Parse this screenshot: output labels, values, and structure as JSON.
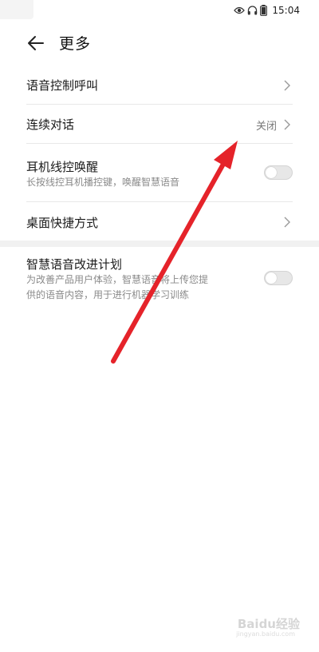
{
  "status_bar": {
    "time": "15:04"
  },
  "header": {
    "title": "更多"
  },
  "items": [
    {
      "title": "语音控制呼叫"
    },
    {
      "title": "连续对话",
      "value": "关闭"
    },
    {
      "title": "耳机线控唤醒",
      "subtitle": "长按线控耳机播控键，唤醒智慧语音",
      "toggle_on": false
    },
    {
      "title": "桌面快捷方式"
    }
  ],
  "improvement": {
    "title": "智慧语音改进计划",
    "subtitle_line1": "为改善产品用户体验，智慧语音将上传您提",
    "subtitle_line2": "供的语音内容，用于进行机器学习训练",
    "toggle_on": false
  },
  "watermark": {
    "text": "Baidu经验",
    "url": "jingyan.baidu.com"
  },
  "colors": {
    "annotation_arrow": "#e5232a",
    "divider": "#e8e8e8",
    "toggle_off": "#e7e7e7"
  }
}
